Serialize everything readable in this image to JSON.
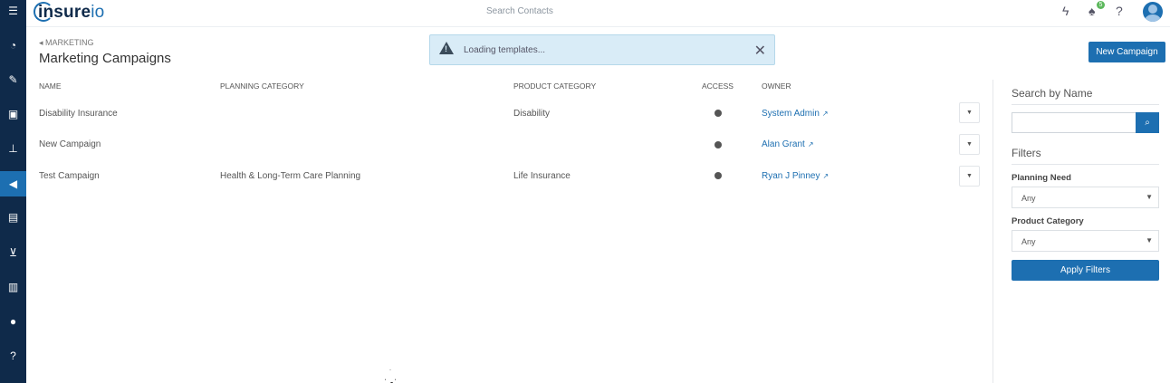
{
  "app": {
    "logo_text_main": "insure",
    "logo_text_accent": "io"
  },
  "topbar": {
    "search_placeholder": "Search Contacts",
    "notification_count": "5"
  },
  "sidebar": {
    "items": [
      "menu-icon",
      "dashboard-icon",
      "pencil-icon",
      "contacts-icon",
      "org-chart-icon",
      "megaphone-icon",
      "book-icon",
      "cart-icon",
      "chart-icon",
      "user-icon",
      "help-icon"
    ],
    "active_item": "megaphone-icon"
  },
  "page": {
    "breadcrumb": "MARKETING",
    "title": "Marketing Campaigns",
    "new_campaign_label": "New Campaign"
  },
  "toast": {
    "message": "Loading templates..."
  },
  "table": {
    "headers": {
      "name": "NAME",
      "planning": "PLANNING CATEGORY",
      "product": "PRODUCT CATEGORY",
      "access": "ACCESS",
      "owner": "OWNER"
    },
    "rows": [
      {
        "name": "Disability Insurance",
        "planning": "",
        "product": "Disability",
        "owner": "System Admin"
      },
      {
        "name": "New Campaign",
        "planning": "",
        "product": "",
        "owner": "Alan Grant"
      },
      {
        "name": "Test Campaign",
        "planning": "Health & Long-Term Care Planning",
        "product": "Life Insurance",
        "owner": "Ryan J Pinney"
      }
    ]
  },
  "filters": {
    "search_heading": "Search by Name",
    "filters_heading": "Filters",
    "planning_need_label": "Planning Need",
    "planning_need_value": "Any",
    "product_category_label": "Product Category",
    "product_category_value": "Any",
    "apply_label": "Apply Filters"
  },
  "colors": {
    "sidebar": "#0f2a4a",
    "accent": "#1d6fb1",
    "toast_bg": "#d9ecf7"
  }
}
